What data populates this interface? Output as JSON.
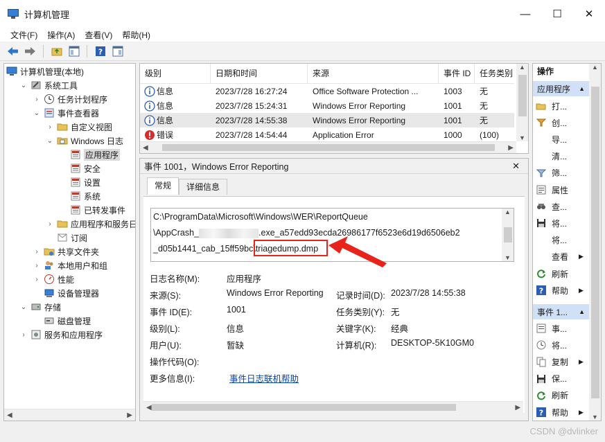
{
  "window": {
    "title": "计算机管理"
  },
  "menu": [
    "文件(F)",
    "操作(A)",
    "查看(V)",
    "帮助(H)"
  ],
  "tree": [
    {
      "label": "计算机管理(本地)",
      "icon": "computer-management-icon",
      "level": 0,
      "chevron": ""
    },
    {
      "label": "系统工具",
      "icon": "tools-icon",
      "level": 1,
      "chevron": "⌄"
    },
    {
      "label": "任务计划程序",
      "icon": "clock-icon",
      "level": 2,
      "chevron": "›"
    },
    {
      "label": "事件查看器",
      "icon": "event-viewer-icon",
      "level": 2,
      "chevron": "⌄"
    },
    {
      "label": "自定义视图",
      "icon": "folder-icon",
      "level": 3,
      "chevron": "›"
    },
    {
      "label": "Windows 日志",
      "icon": "folder-log-icon",
      "level": 3,
      "chevron": "⌄"
    },
    {
      "label": "应用程序",
      "icon": "log-icon",
      "level": 4,
      "chevron": "",
      "selected": true
    },
    {
      "label": "安全",
      "icon": "log-icon",
      "level": 4,
      "chevron": ""
    },
    {
      "label": "设置",
      "icon": "log-icon",
      "level": 4,
      "chevron": ""
    },
    {
      "label": "系统",
      "icon": "log-icon",
      "level": 4,
      "chevron": ""
    },
    {
      "label": "已转发事件",
      "icon": "log-icon",
      "level": 4,
      "chevron": ""
    },
    {
      "label": "应用程序和服务日志",
      "icon": "folder-icon",
      "level": 3,
      "chevron": "›"
    },
    {
      "label": "订阅",
      "icon": "subscription-icon",
      "level": 3,
      "chevron": ""
    },
    {
      "label": "共享文件夹",
      "icon": "shared-folder-icon",
      "level": 2,
      "chevron": "›"
    },
    {
      "label": "本地用户和组",
      "icon": "users-icon",
      "level": 2,
      "chevron": "›"
    },
    {
      "label": "性能",
      "icon": "performance-icon",
      "level": 2,
      "chevron": "›"
    },
    {
      "label": "设备管理器",
      "icon": "device-manager-icon",
      "level": 2,
      "chevron": ""
    },
    {
      "label": "存储",
      "icon": "storage-icon",
      "level": 1,
      "chevron": "⌄"
    },
    {
      "label": "磁盘管理",
      "icon": "disk-icon",
      "level": 2,
      "chevron": ""
    },
    {
      "label": "服务和应用程序",
      "icon": "services-icon",
      "level": 1,
      "chevron": "›"
    }
  ],
  "events": {
    "columns": [
      "级别",
      "日期和时间",
      "来源",
      "事件 ID",
      "任务类别"
    ],
    "rows": [
      {
        "level": "信息",
        "type": "info",
        "datetime": "2023/7/28 16:27:24",
        "source": "Office Software Protection ...",
        "id": "1003",
        "task": "无"
      },
      {
        "level": "信息",
        "type": "info",
        "datetime": "2023/7/28 15:24:31",
        "source": "Windows Error Reporting",
        "id": "1001",
        "task": "无"
      },
      {
        "level": "信息",
        "type": "info",
        "datetime": "2023/7/28 14:55:38",
        "source": "Windows Error Reporting",
        "id": "1001",
        "task": "无",
        "selected": true
      },
      {
        "level": "错误",
        "type": "error",
        "datetime": "2023/7/28 14:54:44",
        "source": "Application Error",
        "id": "1000",
        "task": "(100)"
      }
    ]
  },
  "detail": {
    "header": "事件 1001，Windows Error Reporting",
    "tabs": [
      "常规",
      "详细信息"
    ],
    "description": {
      "line1": "C:\\ProgramData\\Microsoft\\Windows\\WER\\ReportQueue",
      "line2_prefix": "\\AppCrash_",
      "line2_suffix": ".exe_a57edd93ecda26986177f6523e6d19d6506eb2",
      "line3_prefix": "_d05b1441_cab_15ff59bc\\",
      "line3_highlight": "triagedump.dmp"
    },
    "fields": {
      "log_name_label": "日志名称(M):",
      "log_name": "应用程序",
      "source_label": "来源(S):",
      "source": "Windows Error Reporting",
      "logged_label": "记录时间(D):",
      "logged": "2023/7/28 14:55:38",
      "event_id_label": "事件 ID(E):",
      "event_id": "1001",
      "task_label": "任务类别(Y):",
      "task": "无",
      "level_label": "级别(L):",
      "level": "信息",
      "keywords_label": "关键字(K):",
      "keywords": "经典",
      "user_label": "用户(U):",
      "user": "暂缺",
      "computer_label": "计算机(R):",
      "computer": "DESKTOP-5K10GM0",
      "opcode_label": "操作代码(O):",
      "opcode": "",
      "more_label": "更多信息(I):",
      "more_link": "事件日志联机帮助"
    }
  },
  "actions": {
    "title": "操作",
    "section1": "应用程序",
    "items1": [
      {
        "label": "打...",
        "icon": "open-folder-icon"
      },
      {
        "label": "创...",
        "icon": "filter-create-icon"
      },
      {
        "label": "导...",
        "icon": ""
      },
      {
        "label": "清...",
        "icon": ""
      },
      {
        "label": "筛...",
        "icon": "filter-icon"
      },
      {
        "label": "属性",
        "icon": "properties-icon"
      },
      {
        "label": "查...",
        "icon": "find-icon"
      },
      {
        "label": "将...",
        "icon": "save-icon"
      },
      {
        "label": "将...",
        "icon": ""
      },
      {
        "label": "查看",
        "icon": "",
        "arrow": "▶"
      },
      {
        "label": "刷新",
        "icon": "refresh-icon"
      },
      {
        "label": "帮助",
        "icon": "help-icon",
        "arrow": "▶"
      }
    ],
    "section2": "事件 1...",
    "items2": [
      {
        "label": "事...",
        "icon": "event-properties-icon"
      },
      {
        "label": "将...",
        "icon": "attach-task-icon"
      },
      {
        "label": "复制",
        "icon": "copy-icon",
        "arrow": "▶"
      },
      {
        "label": "保...",
        "icon": "save-icon"
      },
      {
        "label": "刷新",
        "icon": "refresh-icon"
      },
      {
        "label": "帮助",
        "icon": "help-icon",
        "arrow": "▶"
      }
    ]
  },
  "watermark": "CSDN @dvlinker",
  "colors": {
    "accent": "#cfe0f7",
    "highlight": "#e8231c",
    "link": "#0645ad"
  }
}
